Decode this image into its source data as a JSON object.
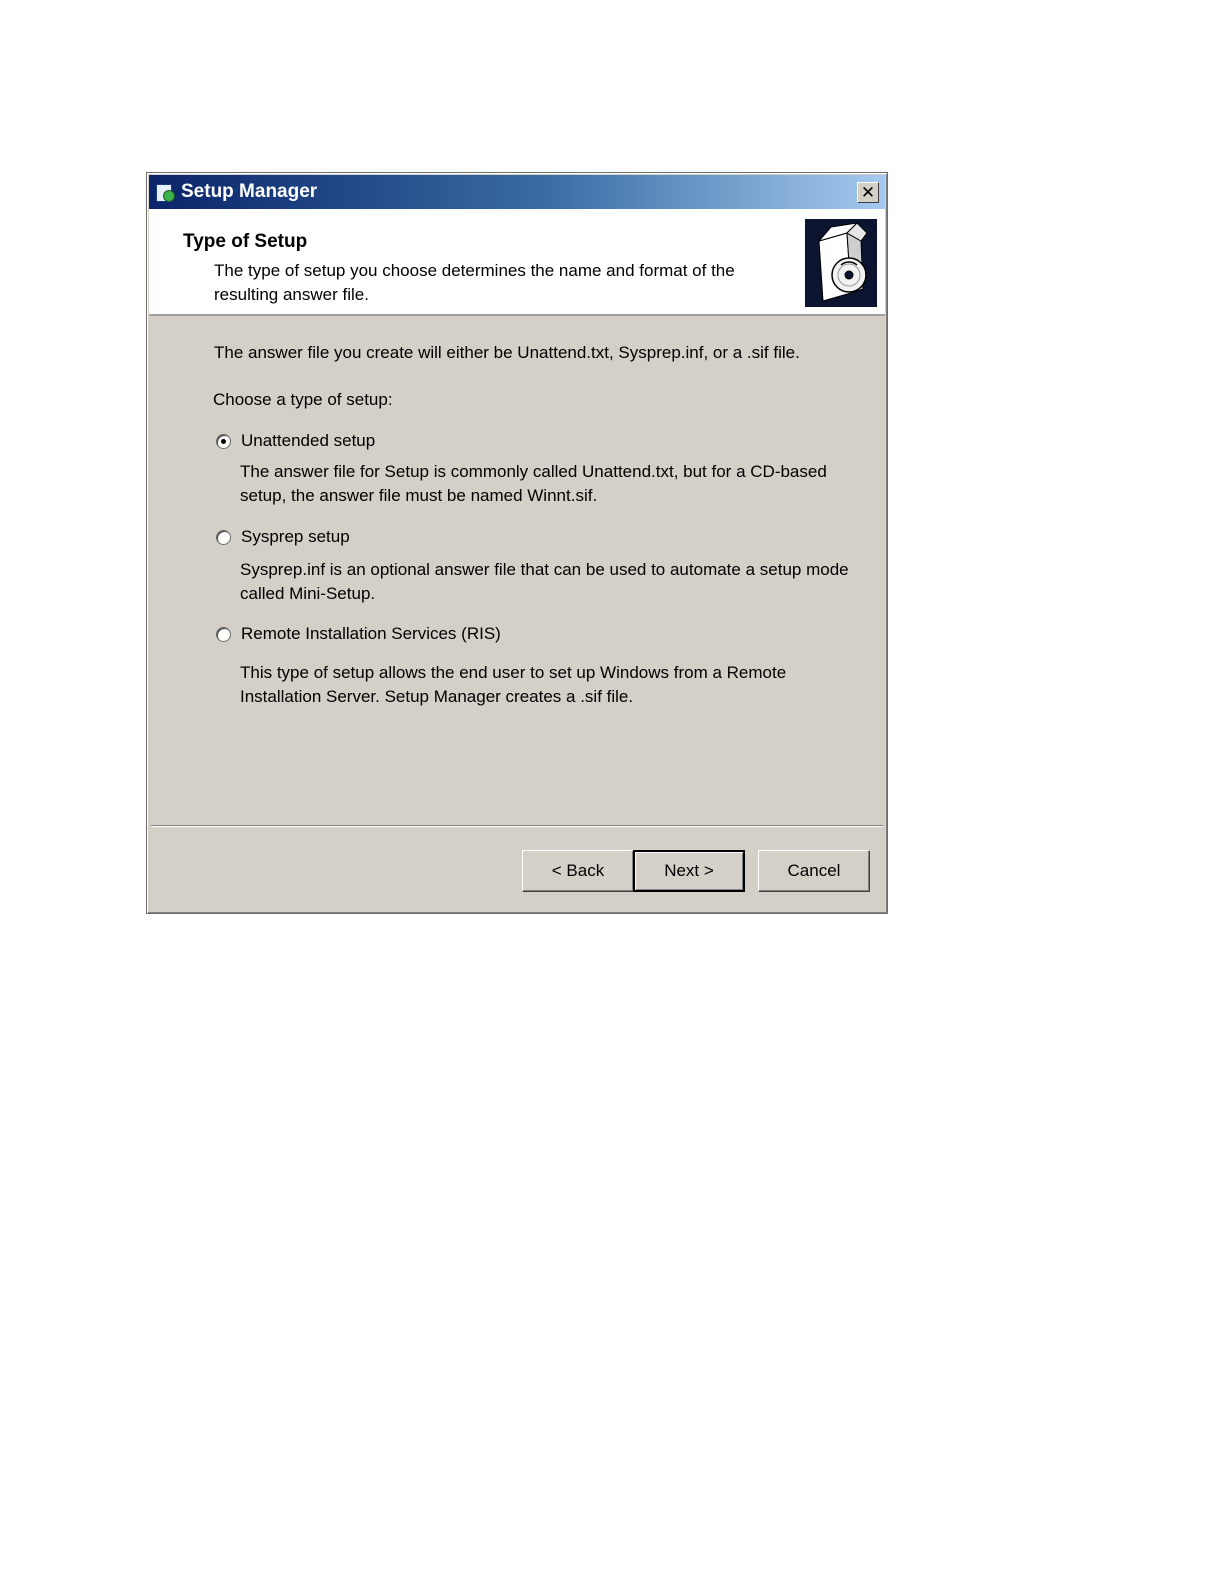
{
  "window": {
    "title": "Setup Manager",
    "close_glyph": "✕"
  },
  "header": {
    "title": "Type of Setup",
    "subtitle": "The type of setup you choose determines the name and format of the resulting answer file."
  },
  "main": {
    "intro": "The answer file you create will either be Unattend.txt, Sysprep.inf, or a .sif file.",
    "choose_label": "Choose a type of setup:",
    "options": [
      {
        "label": "Unattended setup",
        "selected": true,
        "description": "The answer file for Setup is commonly called Unattend.txt, but for a CD-based setup, the answer file must be named Winnt.sif."
      },
      {
        "label": "Sysprep setup",
        "selected": false,
        "description": "Sysprep.inf is an optional answer file that can be used to automate a setup mode called Mini-Setup."
      },
      {
        "label": "Remote Installation Services (RIS)",
        "selected": false,
        "description": "This type of setup allows the end user to set up Windows from a Remote Installation Server. Setup Manager creates a .sif file."
      }
    ]
  },
  "buttons": {
    "back": "< Back",
    "next": "Next >",
    "cancel": "Cancel"
  },
  "colors": {
    "titlebar_start": "#0a246a",
    "titlebar_end": "#a6caf0",
    "dialog_face": "#d4d0c8"
  },
  "icons": [
    "setup-manager-icon",
    "close-icon",
    "setup-cd-box-icon"
  ]
}
